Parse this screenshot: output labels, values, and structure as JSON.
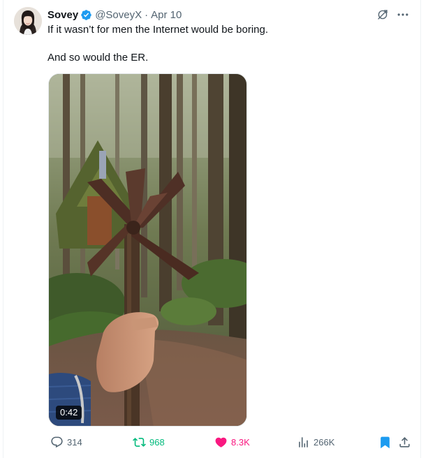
{
  "tweet": {
    "author": {
      "display_name": "Sovey",
      "handle": "@SoveyX",
      "verified": true
    },
    "separator": "·",
    "date": "Apr 10",
    "text": {
      "line1": "If it wasn’t for men the Internet would be boring.",
      "line2": "And so would the ER."
    },
    "media": {
      "type": "video",
      "duration": "0:42"
    }
  },
  "actions": {
    "replies": "314",
    "reposts": "968",
    "likes": "8.3K",
    "views": "266K"
  },
  "icons": {
    "verified": "verified-badge-icon",
    "grok": "grok-icon",
    "more": "more-icon",
    "reply": "reply-icon",
    "repost": "repost-icon",
    "like": "heart-icon",
    "views": "views-icon",
    "bookmark": "bookmark-icon",
    "share": "share-icon"
  },
  "colors": {
    "text_primary": "#0f1419",
    "text_secondary": "#536471",
    "verified_blue": "#1d9bf0",
    "repost_green": "#00ba7c",
    "like_pink": "#f91880"
  }
}
